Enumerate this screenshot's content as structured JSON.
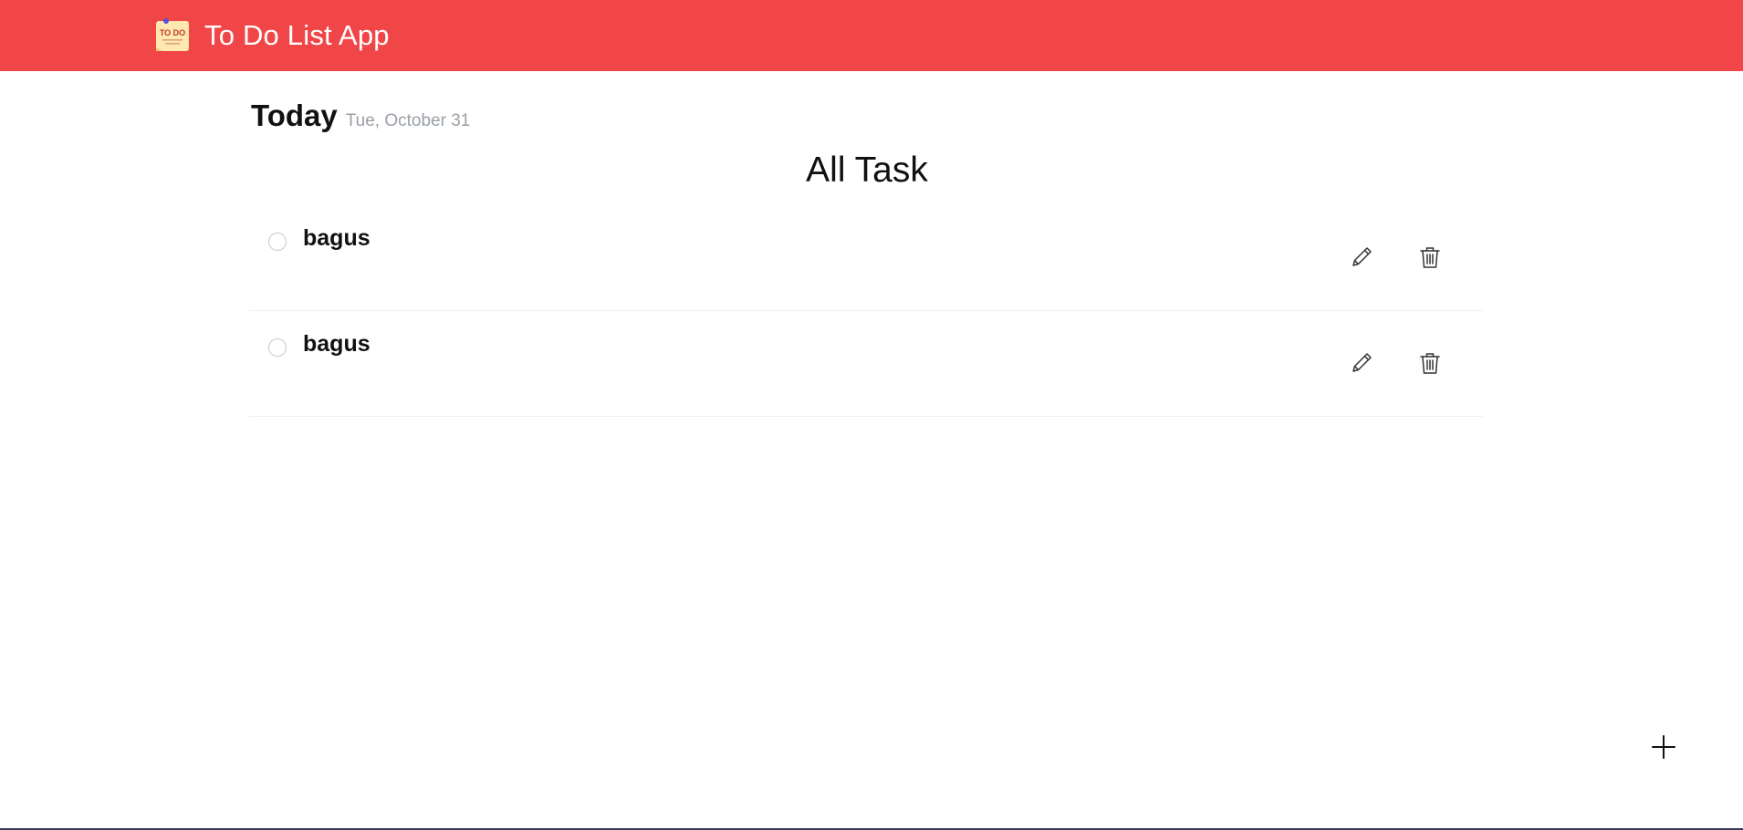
{
  "header": {
    "app_title": "To Do List App",
    "logo_text": "TO DO",
    "background_color": "#f14647"
  },
  "main": {
    "today_label": "Today",
    "date": "Tue, October 31",
    "section_title": "All Task"
  },
  "tasks": [
    {
      "title": "bagus",
      "completed": false,
      "edit_icon": "pencil-icon",
      "delete_icon": "trash-icon"
    },
    {
      "title": "bagus",
      "completed": false,
      "edit_icon": "pencil-icon",
      "delete_icon": "trash-icon"
    }
  ],
  "fab": {
    "icon": "plus-icon"
  }
}
